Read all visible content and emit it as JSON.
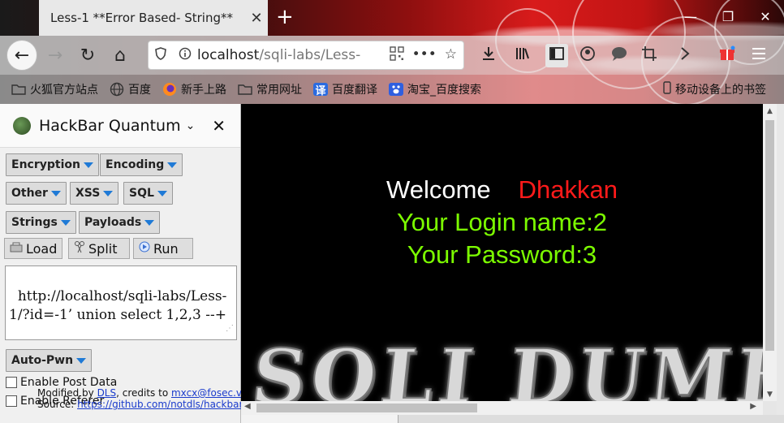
{
  "browser": {
    "tab_title": "Less-1 **Error Based- String**",
    "tab_close": "✕",
    "new_tab": "+",
    "window_controls": {
      "minimize": "—",
      "maximize": "❐",
      "close": "✕"
    },
    "nav": {
      "back": "←",
      "forward": "→",
      "reload": "↻",
      "home": "⌂"
    },
    "url": {
      "host": "localhost",
      "path": "/sqli-labs/Less-",
      "more": "•••",
      "star": "☆"
    },
    "toolbar_icons": [
      "download-icon",
      "library-icon",
      "sidebar-icon",
      "account-icon",
      "chat-icon",
      "screenshot-icon",
      "extensions-icon",
      "gift-icon",
      "menu-icon"
    ]
  },
  "bookmarks": [
    {
      "label": "火狐官方站点",
      "icon": "folder-icon"
    },
    {
      "label": "百度",
      "icon": "globe-icon"
    },
    {
      "label": "新手上路",
      "icon": "firefox-icon"
    },
    {
      "label": "常用网址",
      "icon": "folder-icon"
    },
    {
      "label": "百度翻译",
      "icon": "translate-icon"
    },
    {
      "label": "淘宝_百度搜索",
      "icon": "baidu-icon"
    }
  ],
  "mobile_bookmarks": "移动设备上的书签",
  "hackbar": {
    "title": "HackBar Quantum",
    "menus": {
      "encryption": "Encryption",
      "encoding": "Encoding",
      "other": "Other",
      "xss": "XSS",
      "sql": "SQL",
      "strings": "Strings",
      "payloads": "Payloads",
      "autopwn": "Auto-Pwn"
    },
    "actions": {
      "load": "Load",
      "split": "Split",
      "run": "Run"
    },
    "url_value": "http://localhost/sqli-labs/Less-1/?id=-1’ union select 1,2,3 --+",
    "enable_post": "Enable Post Data",
    "enable_referer": "Enable Referer",
    "credits": {
      "line1_prefix": "Modified by ",
      "line1_dls": "DLS",
      "line1_mid": ", credits to ",
      "line1_email": "mxcx@fosec.vn",
      "line2_prefix": "Source: ",
      "line2_link": "https://github.com/notdls/hackbar"
    }
  },
  "page": {
    "welcome": "Welcome",
    "name": "Dhakkan",
    "login_line": "Your Login name:2",
    "password_line": "Your Password:3",
    "banner": "SQLI DUMB"
  }
}
